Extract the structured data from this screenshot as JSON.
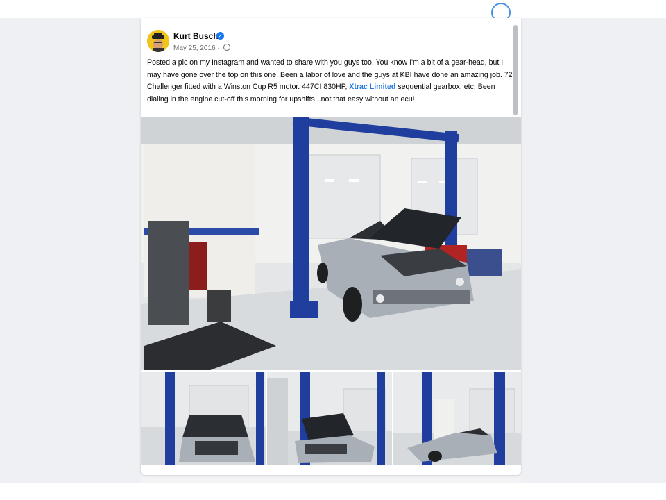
{
  "post": {
    "author": "Kurt Busch",
    "date": "May 25, 2016",
    "meta_separator": " · ",
    "text_before_link": "Posted a pic on my Instagram and wanted to share with you guys too.  You know I'm a bit of a gear-head, but I may have gone over the top on this one. Been a labor of love and the guys at KBI have done an amazing job. 72' Challenger fitted with a Winston Cup R5 motor.  447CI 830HP, ",
    "link_text": "Xtrac Limited",
    "text_after_link": " sequential gearbox, etc. Been dialing in the engine cut-off this morning for upshifts...not that easy without an ecu!"
  },
  "icons": {
    "verified": "verified-badge-icon",
    "privacy": "globe-icon"
  },
  "colors": {
    "link": "#1b74e4",
    "verified": "#1877f2",
    "lift_blue": "#1f3e9e",
    "car_silver": "#a9afb7"
  }
}
